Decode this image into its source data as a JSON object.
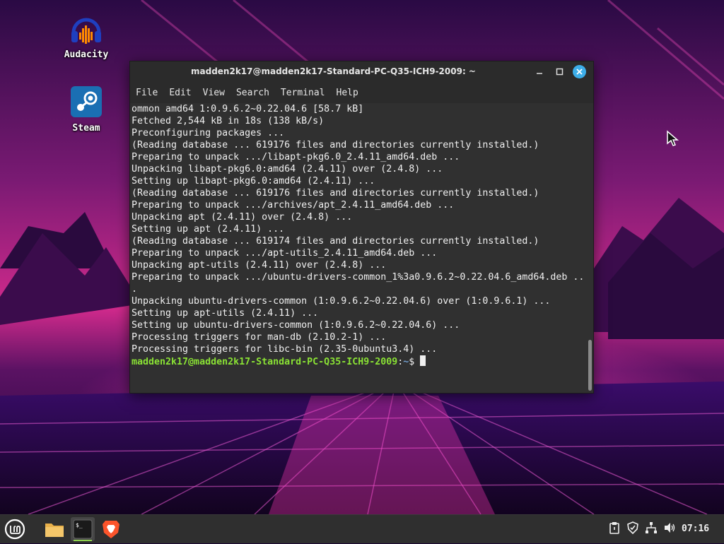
{
  "desktop": {
    "icons": [
      {
        "label": "Audacity",
        "icon": "audacity-icon"
      },
      {
        "label": "Steam",
        "icon": "steam-icon"
      }
    ]
  },
  "terminal": {
    "title": "madden2k17@madden2k17-Standard-PC-Q35-ICH9-2009: ~",
    "menu": [
      "File",
      "Edit",
      "View",
      "Search",
      "Terminal",
      "Help"
    ],
    "lines": [
      "ommon amd64 1:0.9.6.2~0.22.04.6 [58.7 kB]",
      "Fetched 2,544 kB in 18s (138 kB/s)",
      "Preconfiguring packages ...",
      "(Reading database ... 619176 files and directories currently installed.)",
      "Preparing to unpack .../libapt-pkg6.0_2.4.11_amd64.deb ...",
      "Unpacking libapt-pkg6.0:amd64 (2.4.11) over (2.4.8) ...",
      "Setting up libapt-pkg6.0:amd64 (2.4.11) ...",
      "(Reading database ... 619176 files and directories currently installed.)",
      "Preparing to unpack .../archives/apt_2.4.11_amd64.deb ...",
      "Unpacking apt (2.4.11) over (2.4.8) ...",
      "Setting up apt (2.4.11) ...",
      "(Reading database ... 619174 files and directories currently installed.)",
      "Preparing to unpack .../apt-utils_2.4.11_amd64.deb ...",
      "Unpacking apt-utils (2.4.11) over (2.4.8) ...",
      "Preparing to unpack .../ubuntu-drivers-common_1%3a0.9.6.2~0.22.04.6_amd64.deb ..",
      ".",
      "Unpacking ubuntu-drivers-common (1:0.9.6.2~0.22.04.6) over (1:0.9.6.1) ...",
      "Setting up apt-utils (2.4.11) ...",
      "Setting up ubuntu-drivers-common (1:0.9.6.2~0.22.04.6) ...",
      "Processing triggers for man-db (2.10.2-1) ...",
      "Processing triggers for libc-bin (2.35-0ubuntu3.4) ..."
    ],
    "prompt_user": "madden2k17@madden2k17-Standard-PC-Q35-ICH9-2009",
    "prompt_sep": ":",
    "prompt_path": "~",
    "prompt_symbol": "$ "
  },
  "taskbar": {
    "launchers": [
      {
        "icon": "mint-menu-icon"
      },
      {
        "icon": "files-folder-icon"
      },
      {
        "icon": "terminal-icon"
      },
      {
        "icon": "brave-browser-icon"
      }
    ],
    "tray_icons": [
      "clipboard-icon",
      "shield-icon",
      "network-icon",
      "volume-icon"
    ],
    "clock": "07:16"
  }
}
